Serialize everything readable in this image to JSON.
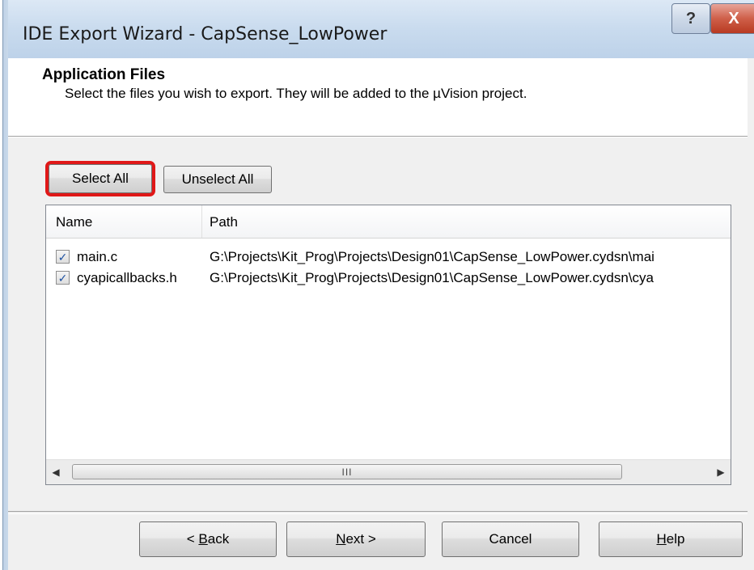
{
  "window": {
    "title": "IDE Export Wizard - CapSense_LowPower",
    "help_glyph": "?",
    "close_glyph": "X"
  },
  "header": {
    "title": "Application Files",
    "subtitle": "Select the files you wish to export. They will be added to the µVision project."
  },
  "buttons": {
    "select_all": "Select All",
    "unselect_all": "Unselect All"
  },
  "file_list": {
    "columns": [
      "Name",
      "Path"
    ],
    "rows": [
      {
        "checked": true,
        "name": "main.c",
        "path": "G:\\Projects\\Kit_Prog\\Projects\\Design01\\CapSense_LowPower.cydsn\\mai"
      },
      {
        "checked": true,
        "name": "cyapicallbacks.h",
        "path": "G:\\Projects\\Kit_Prog\\Projects\\Design01\\CapSense_LowPower.cydsn\\cya"
      }
    ],
    "check_glyph": "✓",
    "scroll_left_glyph": "◀",
    "scroll_right_glyph": "▶",
    "scroll_grip": "III"
  },
  "footer": {
    "back_prefix": "< ",
    "back_key": "B",
    "back_rest": "ack",
    "next_key": "N",
    "next_rest": "ext >",
    "cancel": "Cancel",
    "help_key": "H",
    "help_rest": "elp"
  },
  "colors": {
    "highlight": "#e01818",
    "titlebar": "#c9dbee",
    "close_button": "#cf5f49"
  }
}
